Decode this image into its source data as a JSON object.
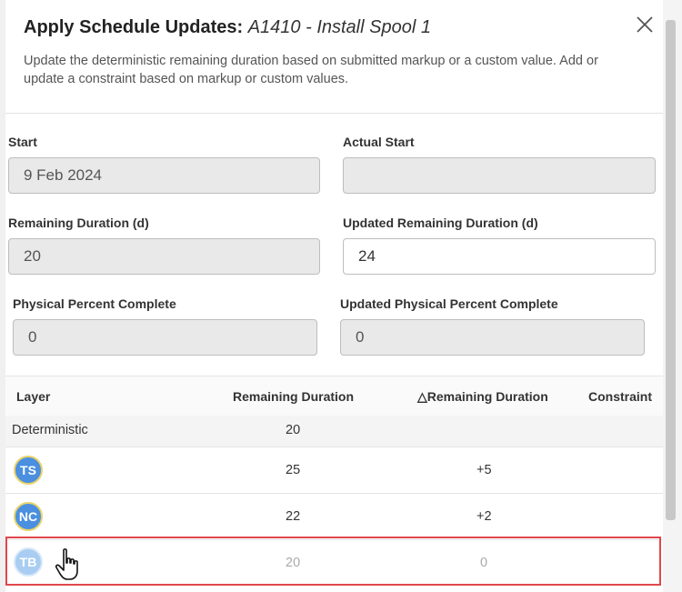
{
  "dialog": {
    "title_prefix": "Apply Schedule Updates:",
    "activity": "A1410 - Install Spool 1",
    "description": "Update the deterministic remaining duration based on submitted markup or a custom value. Add or update a constraint based on markup or custom values.",
    "close_icon": "close-icon"
  },
  "fields": {
    "start": {
      "label": "Start",
      "value": "9 Feb 2024"
    },
    "actual_start": {
      "label": "Actual Start",
      "value": ""
    },
    "remaining_duration": {
      "label": "Remaining Duration (d)",
      "value": "20"
    },
    "updated_remaining_duration": {
      "label": "Updated Remaining Duration (d)",
      "value": "24"
    },
    "physical_percent": {
      "label": "Physical Percent Complete",
      "value": "0"
    },
    "updated_physical_percent": {
      "label": "Updated Physical Percent Complete",
      "value": "0"
    }
  },
  "table": {
    "headers": {
      "layer": "Layer",
      "remaining": "Remaining Duration",
      "delta": "△Remaining Duration",
      "constraint": "Constraint"
    },
    "rows": [
      {
        "layer": "Deterministic",
        "remaining": "20",
        "delta": "",
        "constraint": ""
      },
      {
        "avatar": "TS",
        "remaining": "25",
        "delta": "+5",
        "constraint": ""
      },
      {
        "avatar": "NC",
        "remaining": "22",
        "delta": "+2",
        "constraint": ""
      },
      {
        "avatar": "TB",
        "remaining": "20",
        "delta": "0",
        "constraint": ""
      }
    ]
  },
  "colors": {
    "avatar": "#4a8fe0",
    "highlight": "#e0474c"
  }
}
